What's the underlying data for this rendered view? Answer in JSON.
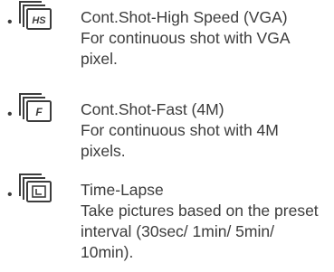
{
  "items": [
    {
      "icon": "burst-high-speed-icon",
      "icon_label": "HS",
      "title": "Cont.Shot-High Speed (VGA)",
      "description": "For continuous shot with VGA pixel."
    },
    {
      "icon": "burst-fast-icon",
      "icon_label": "F",
      "title": "Cont.Shot-Fast (4M)",
      "description": "For continuous shot with 4M pixels."
    },
    {
      "icon": "time-lapse-icon",
      "icon_label": "",
      "title": "Time-Lapse",
      "description": "Take pictures based on the preset interval (30sec/ 1min/ 5min/ 10min)."
    }
  ],
  "bullet": "•",
  "colors": {
    "text": "#3c3c3c",
    "background": "#ffffff"
  }
}
